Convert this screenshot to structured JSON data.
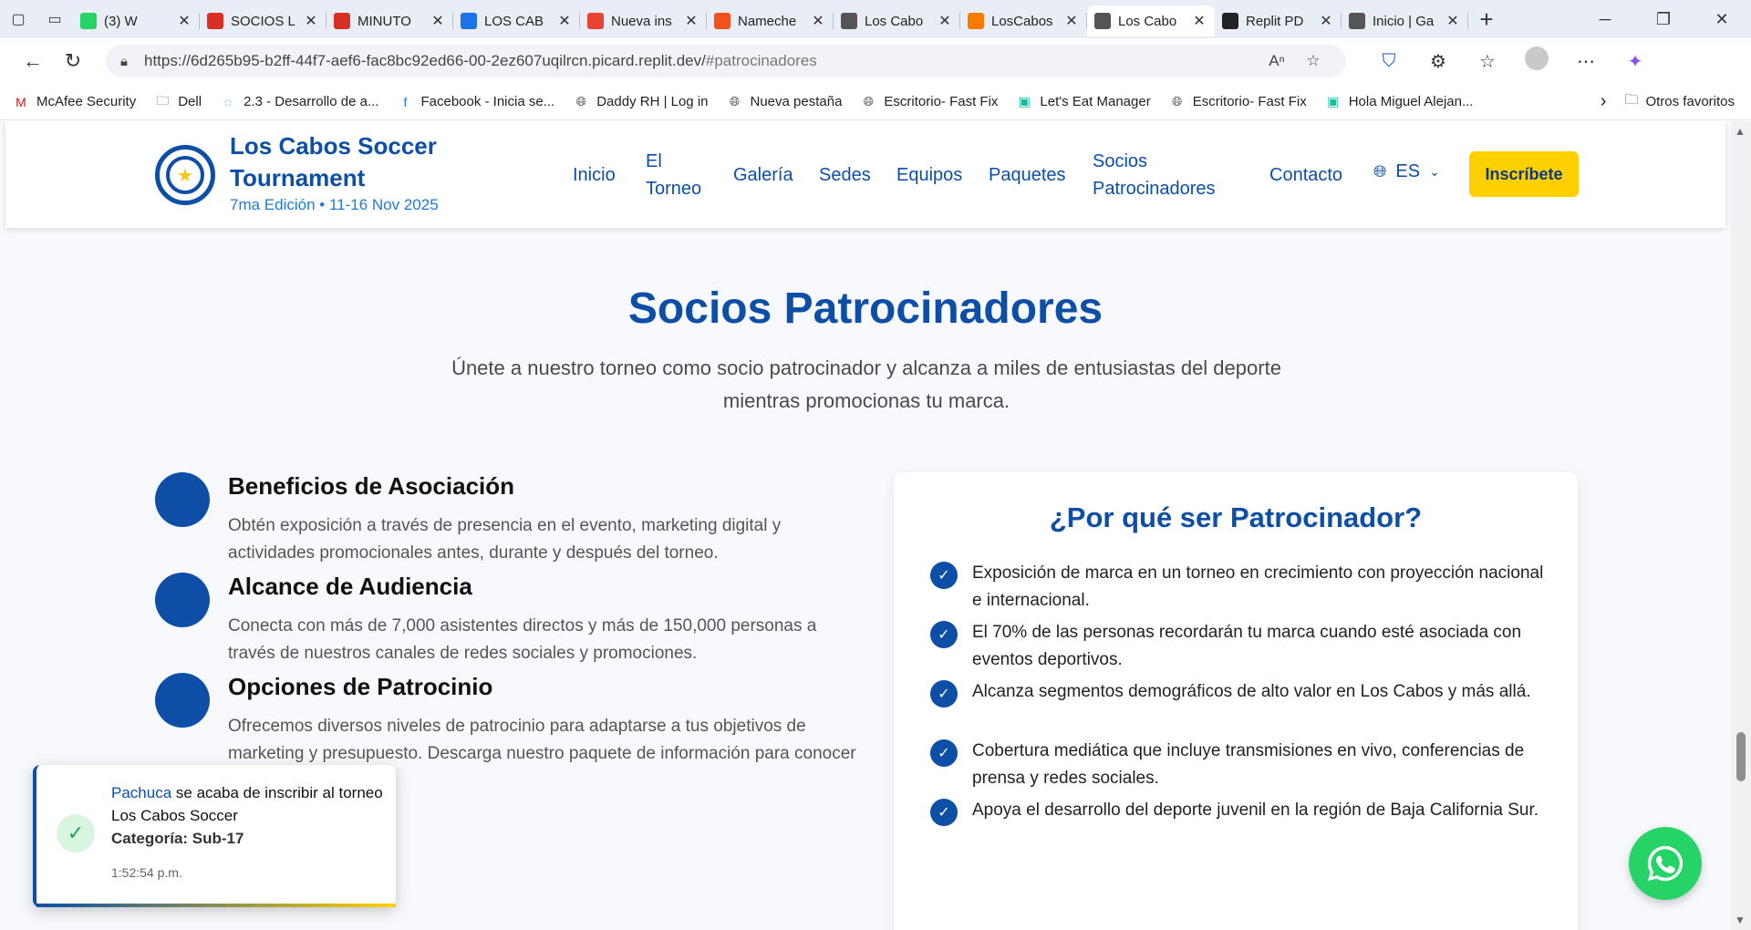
{
  "browser": {
    "tabs": [
      {
        "title": "(3) W",
        "icon": "whatsapp-icon",
        "color": "#25d366"
      },
      {
        "title": "SOCIOS L",
        "icon": "pdf-icon",
        "color": "#d93025"
      },
      {
        "title": "MINUTO",
        "icon": "pdf-icon",
        "color": "#d93025"
      },
      {
        "title": "LOS CAB",
        "icon": "doc-icon",
        "color": "#1a73e8"
      },
      {
        "title": "Nueva ins",
        "icon": "gmail-icon",
        "color": "#ea4335"
      },
      {
        "title": "Nameche",
        "icon": "namecheap-icon",
        "color": "#f4511e"
      },
      {
        "title": "Los Cabo",
        "icon": "globe-icon",
        "color": "#555555"
      },
      {
        "title": "LosCabos",
        "icon": "app-icon",
        "color": "#f57c00"
      },
      {
        "title": "Los Cabo",
        "icon": "globe-icon",
        "color": "#555555",
        "active": true
      },
      {
        "title": "Replit PD",
        "icon": "openai-icon",
        "color": "#222222"
      },
      {
        "title": "Inicio | Ga",
        "icon": "globe-icon",
        "color": "#555555"
      }
    ],
    "url_host": "https://6d265b95-b2ff-44f7-aef6-fac8bc92ed66-00-2ez607uqilrcn.picard.replit.dev/",
    "url_hash": "#patrocinadores",
    "bookmarks": [
      "McAfee Security",
      "Dell",
      "2.3 - Desarrollo de a...",
      "Facebook - Inicia se...",
      "Daddy RH | Log in",
      "Nueva pestaña",
      "Escritorio- Fast Fix",
      "Let's Eat Manager",
      "Escritorio- Fast Fix",
      "Hola Miguel Alejan..."
    ],
    "other_favorites": "Otros favoritos"
  },
  "site": {
    "brand_line1": "Los Cabos Soccer",
    "brand_line2": "Tournament",
    "edition": "7ma Edición • 11-16 Nov 2025",
    "nav": {
      "inicio": "Inicio",
      "torneo_1": "El",
      "torneo_2": "Torneo",
      "galeria": "Galería",
      "sedes": "Sedes",
      "equipos": "Equipos",
      "paquetes": "Paquetes",
      "socios_1": "Socios",
      "socios_2": "Patrocinadores",
      "contacto": "Contacto",
      "lang": "ES",
      "cta": "Inscríbete"
    }
  },
  "section": {
    "title": "Socios Patrocinadores",
    "lead": "Únete a nuestro torneo como socio patrocinador y alcanza a miles de entusiastas del deporte mientras promocionas tu marca.",
    "features": [
      {
        "title": "Beneficios de Asociación",
        "text": "Obtén exposición a través de presencia en el evento, marketing digital y actividades promocionales antes, durante y después del torneo."
      },
      {
        "title": "Alcance de Audiencia",
        "text": "Conecta con más de 7,000 asistentes directos y más de 150,000 personas a través de nuestros canales de redes sociales y promociones."
      },
      {
        "title": "Opciones de Patrocinio",
        "text": "Ofrecemos diversos niveles de patrocinio para adaptarse a tus objetivos de marketing y presupuesto. Descarga nuestro paquete de información para conocer más detalles."
      }
    ],
    "card_title": "¿Por qué ser Patrocinador?",
    "reasons": [
      "Exposición de marca en un torneo en crecimiento con proyección nacional e internacional.",
      "El 70% de las personas recordarán tu marca cuando esté asociada con eventos deportivos.",
      "Alcanza segmentos demográficos de alto valor en Los Cabos y más allá.",
      "Cobertura mediática que incluye transmisiones en vivo, conferencias de prensa y redes sociales.",
      "Apoya el desarrollo del deporte juvenil en la región de Baja California Sur."
    ]
  },
  "toast": {
    "team": "Pachuca",
    "message": "se acaba de inscribir al torneo Los Cabos Soccer",
    "category": "Categoría: Sub-17",
    "time": "1:52:54 p.m."
  },
  "colors": {
    "primary": "#0d4ea6",
    "accent": "#ffd000",
    "whatsapp": "#25d366"
  }
}
